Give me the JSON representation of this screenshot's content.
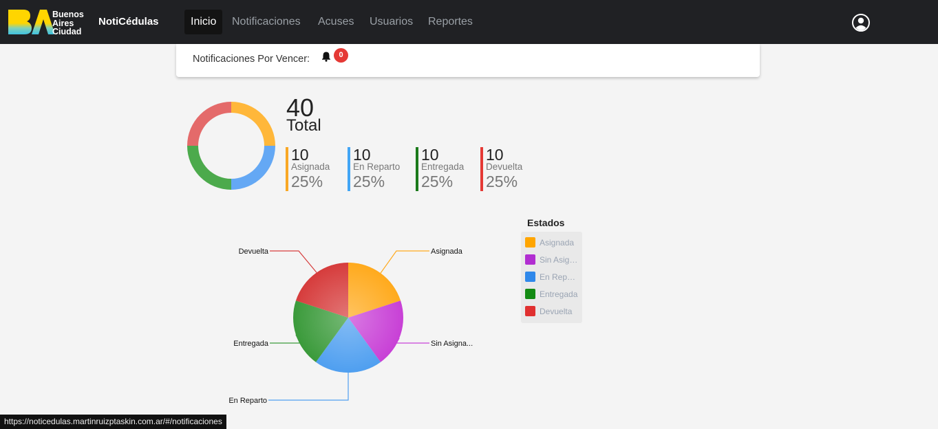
{
  "navbar": {
    "logo_lines": [
      "Buenos",
      "Aires",
      "Ciudad"
    ],
    "brand": "NotiCédulas",
    "items": [
      {
        "label": "Inicio",
        "active": true
      },
      {
        "label": "Notificaciones",
        "active": false
      },
      {
        "label": "Acuses",
        "active": false
      },
      {
        "label": "Usuarios",
        "active": false
      },
      {
        "label": "Reportes",
        "active": false
      }
    ],
    "user_icon": "account-circle-icon"
  },
  "notifications": {
    "label": "Notificaciones Por Vencer:",
    "icon": "bell-icon",
    "count": "0"
  },
  "summary": {
    "total": "40",
    "total_label": "Total",
    "stats": [
      {
        "value": "10",
        "label": "Asignada",
        "percent": "25%",
        "color": "#f9a825"
      },
      {
        "value": "10",
        "label": "En Reparto",
        "percent": "25%",
        "color": "#42a5f5"
      },
      {
        "value": "10",
        "label": "Entregada",
        "percent": "25%",
        "color": "#1b7a1b"
      },
      {
        "value": "10",
        "label": "Devuelta",
        "percent": "25%",
        "color": "#e53935"
      }
    ]
  },
  "chart_data": {
    "type": "pie",
    "categories": [
      "Asignada",
      "Sin Asigna...",
      "En Reparto",
      "Entregada",
      "Devuelta"
    ],
    "values": [
      10,
      10,
      10,
      10,
      10
    ],
    "colors": [
      "#ffaa1d",
      "#c840d6",
      "#4f9ff0",
      "#3a9a3a",
      "#d63c3c"
    ]
  },
  "legend": {
    "title": "Estados",
    "items": [
      {
        "label": "Asignada",
        "color": "#ffa500"
      },
      {
        "label": "Sin Asignar",
        "color": "#b12ed1"
      },
      {
        "label": "En Reparto",
        "color": "#2f88ea"
      },
      {
        "label": "Entregada",
        "color": "#138a13"
      },
      {
        "label": "Devuelta",
        "color": "#e03030"
      }
    ]
  },
  "statusbar": {
    "url": "https://noticedulas.martinruizptaskin.com.ar/#/notificaciones"
  }
}
